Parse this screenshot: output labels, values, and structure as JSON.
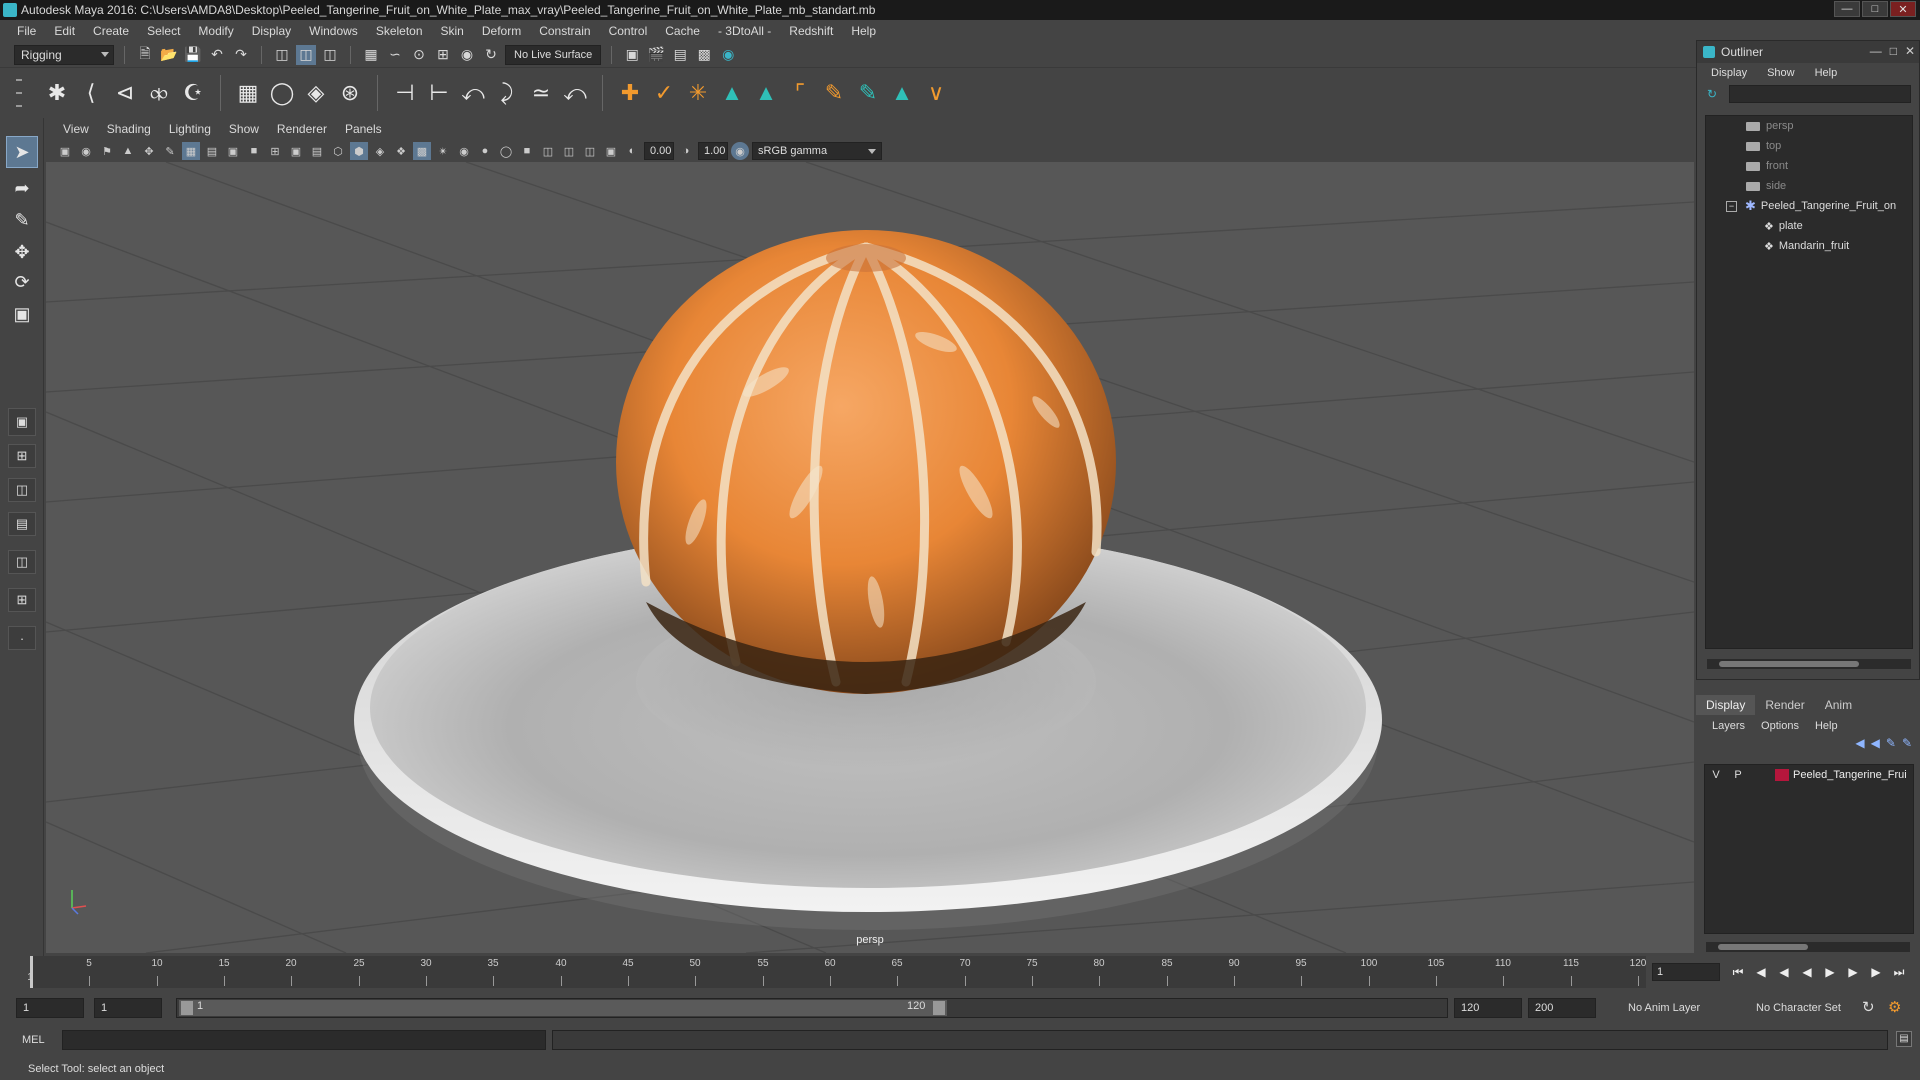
{
  "window": {
    "title": "Autodesk Maya 2016: C:\\Users\\AMDA8\\Desktop\\Peeled_Tangerine_Fruit_on_White_Plate_max_vray\\Peeled_Tangerine_Fruit_on_White_Plate_mb_standart.mb"
  },
  "menubar": [
    "File",
    "Edit",
    "Create",
    "Select",
    "Modify",
    "Display",
    "Windows",
    "Skeleton",
    "Skin",
    "Deform",
    "Constrain",
    "Control",
    "Cache",
    "- 3DtoAll -",
    "Redshift",
    "Help"
  ],
  "statusline": {
    "menuset": "Rigging",
    "live_surface": "No Live Surface"
  },
  "panel": {
    "menus": [
      "View",
      "Shading",
      "Lighting",
      "Show",
      "Renderer",
      "Panels"
    ],
    "exposure": "0.00",
    "gamma": "1.00",
    "color_space": "sRGB gamma",
    "camera_label": "persp"
  },
  "outliner": {
    "title": "Outliner",
    "menus": [
      "Display",
      "Show",
      "Help"
    ],
    "items": [
      {
        "label": "persp"
      },
      {
        "label": "top"
      },
      {
        "label": "front"
      },
      {
        "label": "side"
      },
      {
        "label": "Peeled_Tangerine_Fruit_on"
      },
      {
        "label": "plate"
      },
      {
        "label": "Mandarin_fruit"
      }
    ]
  },
  "layer_editor": {
    "tabs": [
      "Display",
      "Render",
      "Anim"
    ],
    "menus": [
      "Layers",
      "Options",
      "Help"
    ],
    "layer": {
      "v": "V",
      "p": "P",
      "name": "Peeled_Tangerine_Frui",
      "color": "#b5163c"
    }
  },
  "timeslider": {
    "ticks": [
      "5",
      "10",
      "15",
      "20",
      "25",
      "30",
      "35",
      "40",
      "45",
      "50",
      "55",
      "60",
      "65",
      "70",
      "75",
      "80",
      "85",
      "90",
      "95",
      "100",
      "105",
      "110",
      "115",
      "120"
    ],
    "current_frame": "1",
    "first_tick": "1"
  },
  "range": {
    "start": "1",
    "current_start": "1",
    "range_start": "1",
    "range_end": "120",
    "end": "120",
    "anim_end": "200",
    "anim_layer": "No Anim Layer",
    "character_set": "No Character Set"
  },
  "cmdline": {
    "label": "MEL"
  },
  "helpline": {
    "text": "Select Tool: select an object"
  }
}
